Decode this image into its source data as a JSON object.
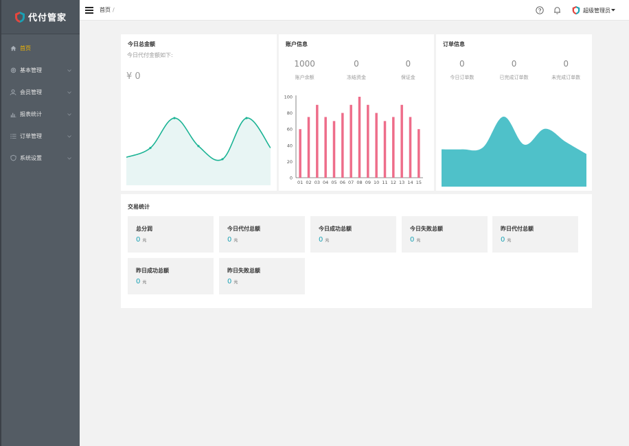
{
  "app": {
    "name": "代付管家"
  },
  "sidebar": {
    "items": [
      {
        "label": "首页",
        "icon": "home-icon",
        "active": true
      },
      {
        "label": "基本管理",
        "icon": "settings-icon"
      },
      {
        "label": "会员管理",
        "icon": "users-icon"
      },
      {
        "label": "报表统计",
        "icon": "bar-chart-icon"
      },
      {
        "label": "订单管理",
        "icon": "list-icon"
      },
      {
        "label": "系统设置",
        "icon": "shield-icon"
      }
    ]
  },
  "header": {
    "breadcrumb": "首页",
    "breadcrumb_sep": "/",
    "user": "超级管理员"
  },
  "today_total": {
    "title": "今日总金额",
    "subtitle": "今日代付金额如下:",
    "amount": "¥ 0"
  },
  "account": {
    "title": "账户信息",
    "stats": [
      {
        "value": "1000",
        "label": "账户余额"
      },
      {
        "value": "0",
        "label": "冻结资金"
      },
      {
        "value": "0",
        "label": "保证金"
      }
    ]
  },
  "order": {
    "title": "订单信息",
    "stats": [
      {
        "value": "0",
        "label": "今日订单数"
      },
      {
        "value": "0",
        "label": "已完成订单数"
      },
      {
        "value": "0",
        "label": "未完成订单数"
      }
    ]
  },
  "trade": {
    "title": "交易统计",
    "unit": "元",
    "tiles": [
      {
        "label": "总分润",
        "value": "0"
      },
      {
        "label": "今日代付总额",
        "value": "0"
      },
      {
        "label": "今日成功总额",
        "value": "0"
      },
      {
        "label": "今日失败总额",
        "value": "0"
      },
      {
        "label": "昨日代付总额",
        "value": "0"
      },
      {
        "label": "昨日成功总额",
        "value": "0"
      },
      {
        "label": "昨日失败总额",
        "value": "0"
      }
    ]
  },
  "chart_data": [
    {
      "type": "line",
      "x": [
        0,
        1,
        2,
        3,
        4,
        5,
        6
      ],
      "values": [
        30,
        40,
        72,
        42,
        28,
        72,
        40
      ],
      "ylim": [
        0,
        100
      ],
      "color": "#1ab394",
      "fill": "#e8f5f4"
    },
    {
      "type": "bar",
      "categories": [
        "01",
        "02",
        "03",
        "04",
        "05",
        "06",
        "07",
        "08",
        "09",
        "10",
        "11",
        "12",
        "13",
        "14",
        "15"
      ],
      "values": [
        60,
        75,
        90,
        75,
        70,
        80,
        90,
        100,
        90,
        80,
        70,
        75,
        90,
        75,
        60
      ],
      "ylim": [
        0,
        100
      ],
      "yticks": [
        0,
        20,
        40,
        60,
        80,
        100
      ],
      "color": "#ee6d8a"
    },
    {
      "type": "area",
      "x": [
        0,
        1,
        2,
        3,
        4,
        5,
        6,
        7
      ],
      "values": [
        40,
        40,
        42,
        75,
        45,
        62,
        48,
        35
      ],
      "ylim": [
        0,
        100
      ],
      "color": "#4fc1c9"
    }
  ]
}
